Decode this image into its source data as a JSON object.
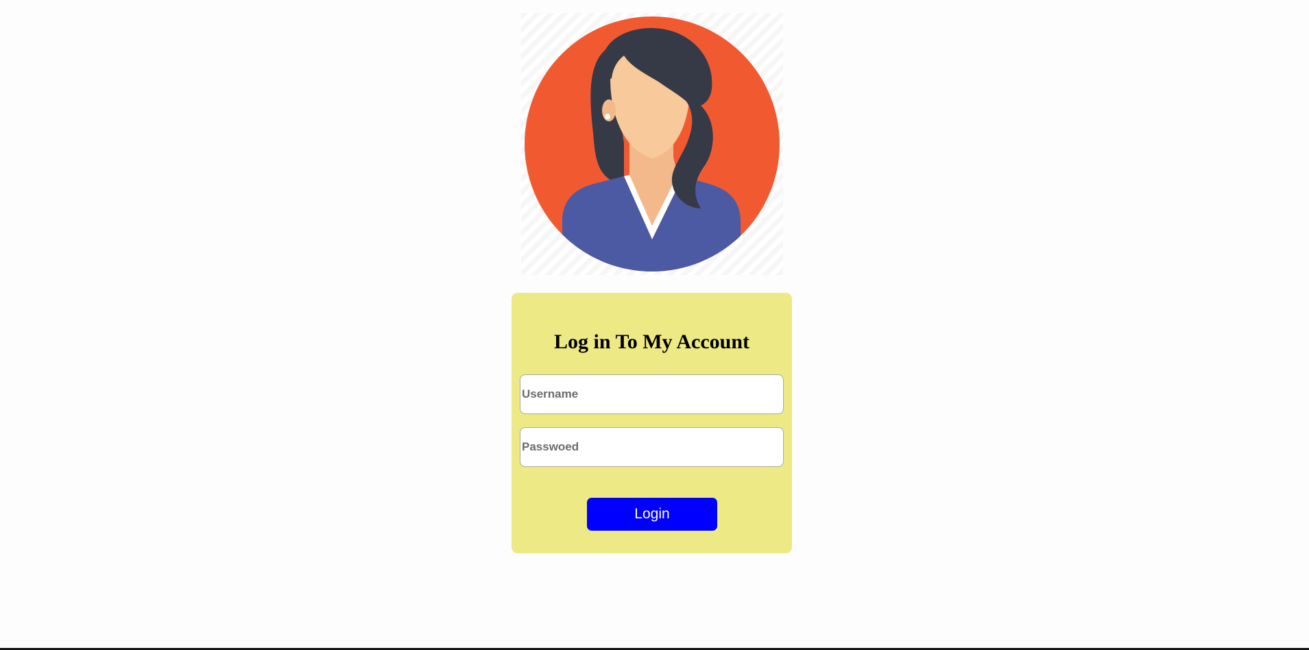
{
  "colors": {
    "page_background": "#fdfdfd",
    "card_background": "#ede984",
    "button_background": "#0000ff",
    "button_text": "#ffffff",
    "avatar_circle": "#f15a31",
    "avatar_hair": "#363a46",
    "avatar_skin": "#f7c99b",
    "avatar_shirt": "#4c5aa4"
  },
  "avatar": {
    "icon": "female-user-avatar-icon"
  },
  "login_card": {
    "title": "Log in To My Account",
    "username": {
      "placeholder": "Username",
      "value": ""
    },
    "password": {
      "placeholder": "Passwoed",
      "value": ""
    },
    "login_button_label": "Login"
  }
}
